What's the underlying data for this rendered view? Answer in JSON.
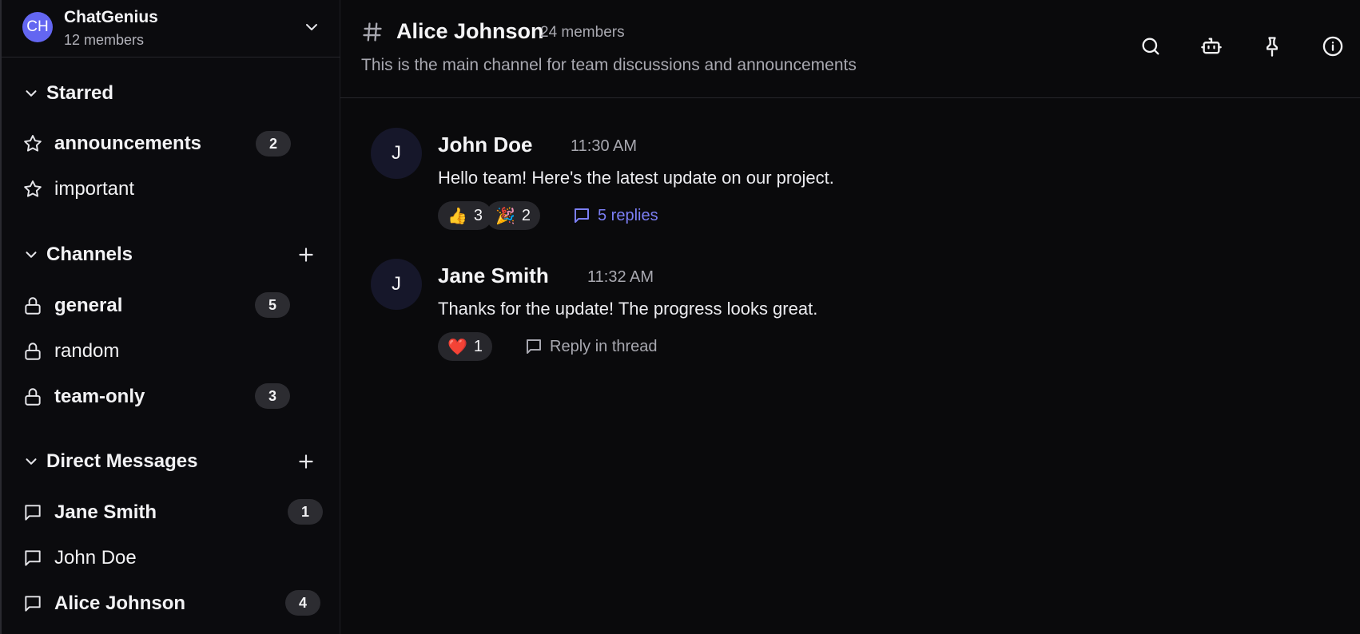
{
  "workspace": {
    "initials": "CH",
    "name": "ChatGenius",
    "members": "12 members"
  },
  "sections": {
    "starred": {
      "title": "Starred",
      "items": [
        {
          "label": "announcements",
          "badge": "2",
          "unread": true
        },
        {
          "label": "important",
          "unread": false
        }
      ]
    },
    "channels": {
      "title": "Channels",
      "items": [
        {
          "label": "general",
          "badge": "5",
          "unread": true
        },
        {
          "label": "random",
          "unread": false
        },
        {
          "label": "team-only",
          "badge": "3",
          "unread": true
        }
      ]
    },
    "dms": {
      "title": "Direct Messages",
      "items": [
        {
          "label": "Jane Smith",
          "badge": "1",
          "unread": true
        },
        {
          "label": "John Doe",
          "unread": false
        },
        {
          "label": "Alice Johnson",
          "badge": "4",
          "unread": true
        }
      ]
    }
  },
  "channel": {
    "title": "Alice Johnson",
    "members": "24 members",
    "description": "This is the main channel for team discussions and announcements"
  },
  "messages": [
    {
      "avatar": "J",
      "author": "John Doe",
      "time": "11:30 AM",
      "text": "Hello team! Here's the latest update on our project.",
      "reactions": [
        {
          "emoji": "👍",
          "count": "3"
        },
        {
          "emoji": "🎉",
          "count": "2"
        }
      ],
      "thread": "5 replies"
    },
    {
      "avatar": "J",
      "author": "Jane Smith",
      "time": "11:32 AM",
      "text": "Thanks for the update! The progress looks great.",
      "reactions": [
        {
          "emoji": "❤️",
          "count": "1"
        }
      ],
      "thread": "Reply in thread"
    }
  ],
  "icons": {
    "header": [
      "search-icon",
      "bot-icon",
      "pin-icon",
      "info-icon"
    ]
  },
  "colors": {
    "accent": "#6366f1",
    "link": "#7c7ff5",
    "background": "#0a0a0c"
  }
}
